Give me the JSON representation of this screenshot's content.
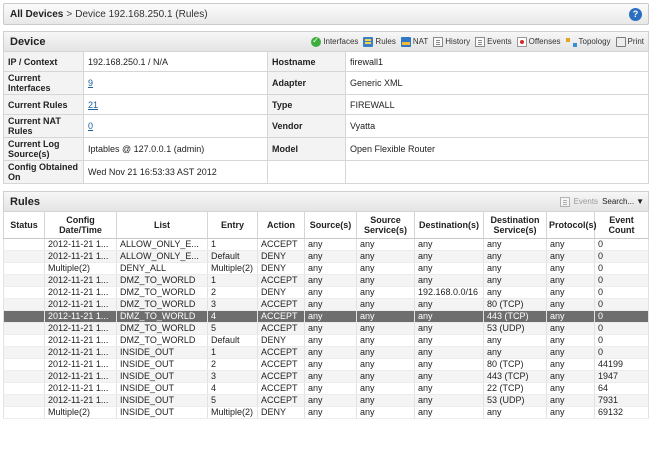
{
  "breadcrumb": {
    "root": "All Devices",
    "separator": ">",
    "current": "Device 192.168.250.1 (Rules)"
  },
  "device_panel": {
    "title": "Device",
    "toolbar": [
      {
        "label": "Interfaces",
        "icon": "check-icon"
      },
      {
        "label": "Rules",
        "icon": "rules-icon"
      },
      {
        "label": "NAT",
        "icon": "nat-icon"
      },
      {
        "label": "History",
        "icon": "history-icon"
      },
      {
        "label": "Events",
        "icon": "events-icon"
      },
      {
        "label": "Offenses",
        "icon": "offenses-icon"
      },
      {
        "label": "Topology",
        "icon": "topology-icon"
      },
      {
        "label": "Print",
        "icon": "print-icon"
      }
    ],
    "fields": {
      "ip_context_label": "IP / Context",
      "ip_context_value": "192.168.250.1 / N/A",
      "hostname_label": "Hostname",
      "hostname_value": "firewall1",
      "current_interfaces_label": "Current Interfaces",
      "current_interfaces_value": "9",
      "adapter_label": "Adapter",
      "adapter_value": "Generic XML",
      "current_rules_label": "Current Rules",
      "current_rules_value": "21",
      "type_label": "Type",
      "type_value": "FIREWALL",
      "current_nat_rules_label": "Current NAT Rules",
      "current_nat_rules_value": "0",
      "vendor_label": "Vendor",
      "vendor_value": "Vyatta",
      "current_log_source_label": "Current Log Source(s)",
      "current_log_source_value": "Iptables @ 127.0.0.1 (admin)",
      "model_label": "Model",
      "model_value": "Open Flexible Router",
      "config_obtained_label": "Config Obtained On",
      "config_obtained_value": "Wed Nov 21 16:53:33 AST 2012"
    }
  },
  "rules_panel": {
    "title": "Rules",
    "events_label": "Events",
    "search_label": "Search...",
    "columns": [
      "Status",
      "Config Date/Time",
      "List",
      "Entry",
      "Action",
      "Source(s)",
      "Source Service(s)",
      "Destination(s)",
      "Destination Service(s)",
      "Protocol(s)",
      "Event Count"
    ],
    "rows": [
      [
        "",
        "2012-11-21 1...",
        "ALLOW_ONLY_E...",
        "1",
        "ACCEPT",
        "any",
        "any",
        "any",
        "any",
        "any",
        "0"
      ],
      [
        "",
        "2012-11-21 1...",
        "ALLOW_ONLY_E...",
        "Default",
        "DENY",
        "any",
        "any",
        "any",
        "any",
        "any",
        "0"
      ],
      [
        "",
        "Multiple(2)",
        "DENY_ALL",
        "Multiple(2)",
        "DENY",
        "any",
        "any",
        "any",
        "any",
        "any",
        "0"
      ],
      [
        "",
        "2012-11-21 1...",
        "DMZ_TO_WORLD",
        "1",
        "ACCEPT",
        "any",
        "any",
        "any",
        "any",
        "any",
        "0"
      ],
      [
        "",
        "2012-11-21 1...",
        "DMZ_TO_WORLD",
        "2",
        "DENY",
        "any",
        "any",
        "192.168.0.0/16",
        "any",
        "any",
        "0"
      ],
      [
        "",
        "2012-11-21 1...",
        "DMZ_TO_WORLD",
        "3",
        "ACCEPT",
        "any",
        "any",
        "any",
        "80 (TCP)",
        "any",
        "0"
      ],
      [
        "",
        "2012-11-21 1...",
        "DMZ_TO_WORLD",
        "4",
        "ACCEPT",
        "any",
        "any",
        "any",
        "443 (TCP)",
        "any",
        "0"
      ],
      [
        "",
        "2012-11-21 1...",
        "DMZ_TO_WORLD",
        "5",
        "ACCEPT",
        "any",
        "any",
        "any",
        "53 (UDP)",
        "any",
        "0"
      ],
      [
        "",
        "2012-11-21 1...",
        "DMZ_TO_WORLD",
        "Default",
        "DENY",
        "any",
        "any",
        "any",
        "any",
        "any",
        "0"
      ],
      [
        "",
        "2012-11-21 1...",
        "INSIDE_OUT",
        "1",
        "ACCEPT",
        "any",
        "any",
        "any",
        "any",
        "any",
        "0"
      ],
      [
        "",
        "2012-11-21 1...",
        "INSIDE_OUT",
        "2",
        "ACCEPT",
        "any",
        "any",
        "any",
        "80 (TCP)",
        "any",
        "44199"
      ],
      [
        "",
        "2012-11-21 1...",
        "INSIDE_OUT",
        "3",
        "ACCEPT",
        "any",
        "any",
        "any",
        "443 (TCP)",
        "any",
        "1947"
      ],
      [
        "",
        "2012-11-21 1...",
        "INSIDE_OUT",
        "4",
        "ACCEPT",
        "any",
        "any",
        "any",
        "22 (TCP)",
        "any",
        "64"
      ],
      [
        "",
        "2012-11-21 1...",
        "INSIDE_OUT",
        "5",
        "ACCEPT",
        "any",
        "any",
        "any",
        "53 (UDP)",
        "any",
        "7931"
      ],
      [
        "",
        "Multiple(2)",
        "INSIDE_OUT",
        "Multiple(2)",
        "DENY",
        "any",
        "any",
        "any",
        "any",
        "any",
        "69132"
      ]
    ],
    "selected_row": 6
  },
  "colors": {
    "link": "#1a5e9e",
    "selected_row": "#6e6e6e",
    "help_icon": "#2a6ebf"
  }
}
